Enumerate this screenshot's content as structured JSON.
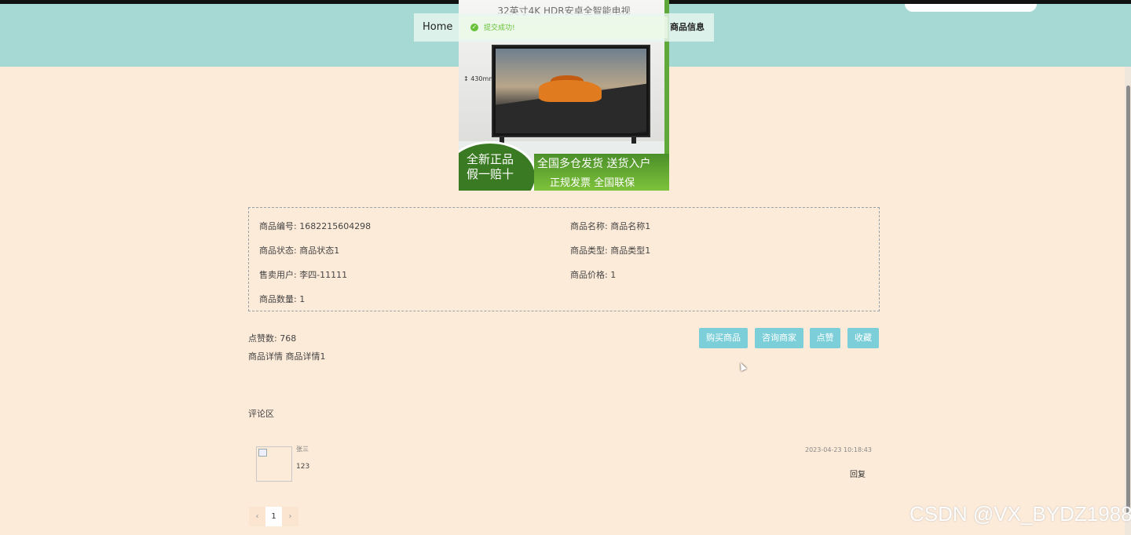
{
  "header": {
    "nav_home": "Home",
    "nav_product_info": "商品信息"
  },
  "product_image": {
    "title_strip": "32英寸4K HDR安卓全智能电视",
    "dimension_label": "430mm",
    "badge_line1": "全新正品",
    "badge_line2": "假一赔十",
    "bar_line1": "全国多仓发货  送货入户",
    "bar_line2": "正规发票   全国联保"
  },
  "toast": {
    "icon": "check-circle-icon",
    "message": "提交成功!"
  },
  "info": {
    "product_no": "商品编号: 1682215604298",
    "product_name": "商品名称: 商品名称1",
    "product_status": "商品状态: 商品状态1",
    "product_type": "商品类型: 商品类型1",
    "seller": "售卖用户: 李四-11111",
    "price": "商品价格: 1",
    "quantity": "商品数量: 1"
  },
  "likes_text": "点赞数: 768",
  "detail_text": "商品详情  商品详情1",
  "buttons": {
    "buy": "购买商品",
    "consult": "咨询商家",
    "like": "点赞",
    "favorite": "收藏"
  },
  "comments": {
    "title": "评论区",
    "items": [
      {
        "user": "张三",
        "content": "123",
        "time": "2023-04-23 10:18:43",
        "reply": "回复"
      }
    ]
  },
  "pagination": {
    "prev": "‹",
    "current": "1",
    "next": "›"
  },
  "watermark": "CSDN @VX_BYDZ1988",
  "colors": {
    "header_bg": "#a6d9d4",
    "page_bg": "#fdebd9",
    "button_bg": "#7ccfd8",
    "success": "#67c23a"
  }
}
